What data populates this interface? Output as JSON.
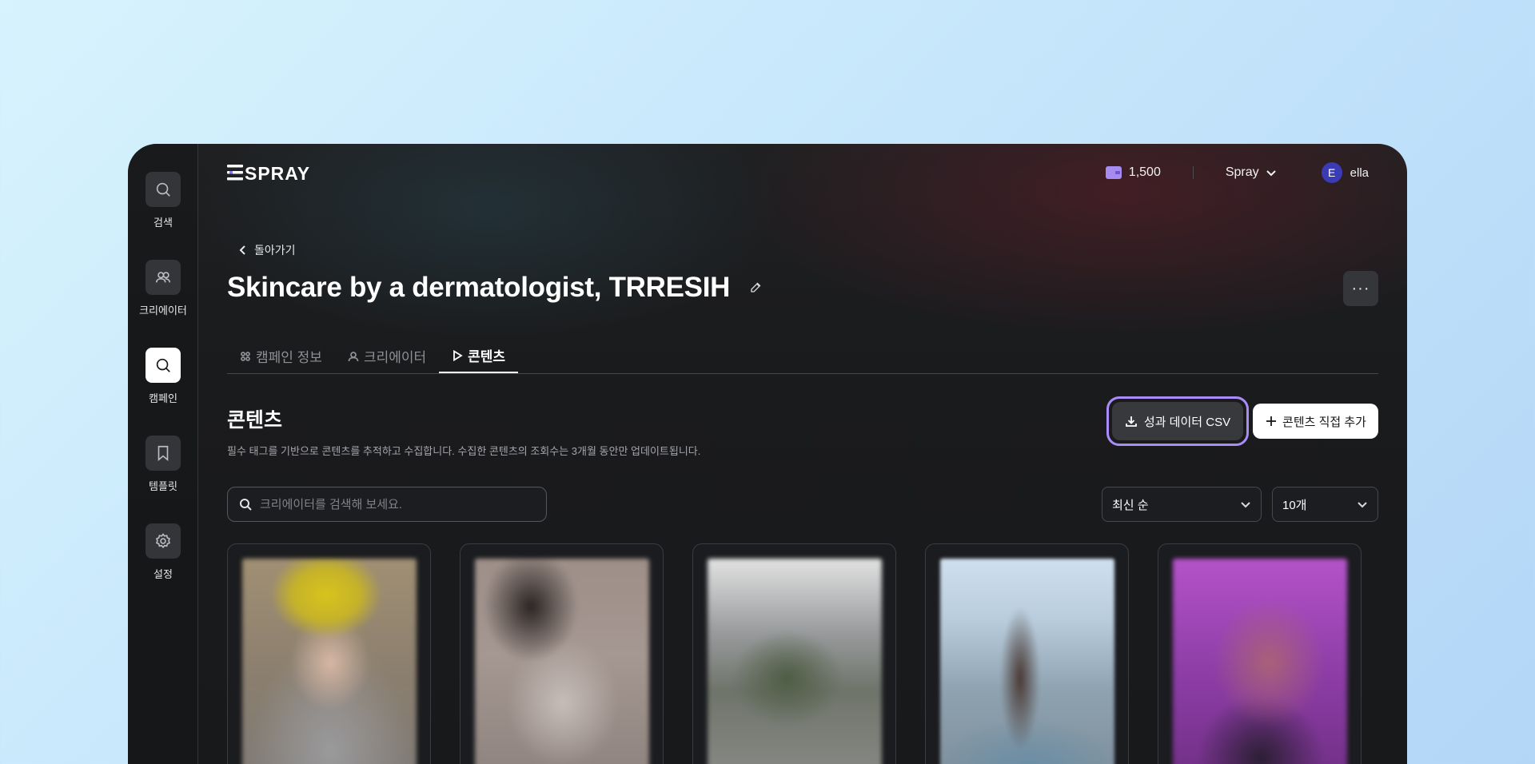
{
  "sidebar": {
    "items": [
      {
        "label": "검색",
        "icon": "search-icon",
        "active": false
      },
      {
        "label": "크리에이터",
        "icon": "users-icon",
        "active": false
      },
      {
        "label": "캠페인",
        "icon": "search-icon",
        "active": true
      },
      {
        "label": "템플릿",
        "icon": "bookmark-icon",
        "active": false
      },
      {
        "label": "설정",
        "icon": "gear-icon",
        "active": false
      }
    ]
  },
  "header": {
    "logo_text": "SPRAY",
    "credits": "1,500",
    "org": "Spray",
    "user_initial": "E",
    "user_name": "ella"
  },
  "back_label": "돌아가기",
  "page_title": "Skincare by a dermatologist, TRRESIH",
  "more_label": "···",
  "tabs": [
    {
      "label": "캠페인 정보",
      "icon": "campaign-info-icon",
      "active": false
    },
    {
      "label": "크리에이터",
      "icon": "user-icon",
      "active": false
    },
    {
      "label": "콘텐츠",
      "icon": "play-icon",
      "active": true
    }
  ],
  "content": {
    "title": "콘텐츠",
    "description": "필수 태그를 기반으로 콘텐츠를 추적하고 수집합니다. 수집한 콘텐츠의 조회수는 3개월 동안만 업데이트됩니다.",
    "csv_button": "성과 데이터 CSV",
    "add_button": "콘텐츠 직접 추가",
    "search_placeholder": "크리에이터를 검색해 보세요.",
    "sort_value": "최신 순",
    "count_value": "10개"
  },
  "colors": {
    "accent": "#a98cf5",
    "background": "#1a1b1d",
    "avatar": "#3a3bb5"
  }
}
